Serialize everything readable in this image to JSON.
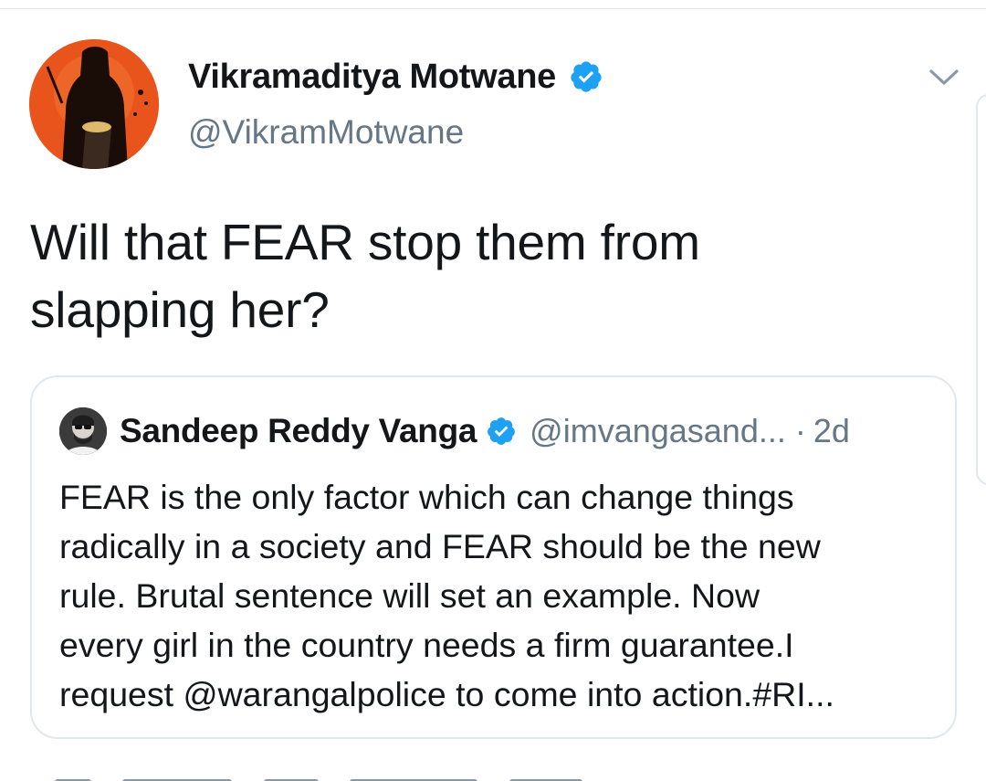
{
  "tweet": {
    "author_name": "Vikramaditya Motwane",
    "author_handle": "@VikramMotwane",
    "verified_icon": "verified-badge-icon",
    "menu_icon": "chevron-down-icon",
    "text_lines": [
      "Will that FEAR stop them from",
      "slapping her?"
    ]
  },
  "quoted": {
    "author_name": "Sandeep Reddy Vanga",
    "author_handle": "@imvangasand...",
    "separator": "·",
    "time": "2d",
    "text_lines": [
      "FEAR is the only factor which can change things",
      "radically in a society and FEAR should be the new",
      "rule. Brutal sentence will set an example. Now",
      "every girl in the country needs a firm guarantee.I",
      "request @warangalpolice to come into action.#RI..."
    ]
  },
  "colors": {
    "text": "#14171a",
    "secondary": "#657786",
    "verified": "#1da1f2",
    "border": "#e1e8ed",
    "avatar_bg": "#e8541c"
  }
}
